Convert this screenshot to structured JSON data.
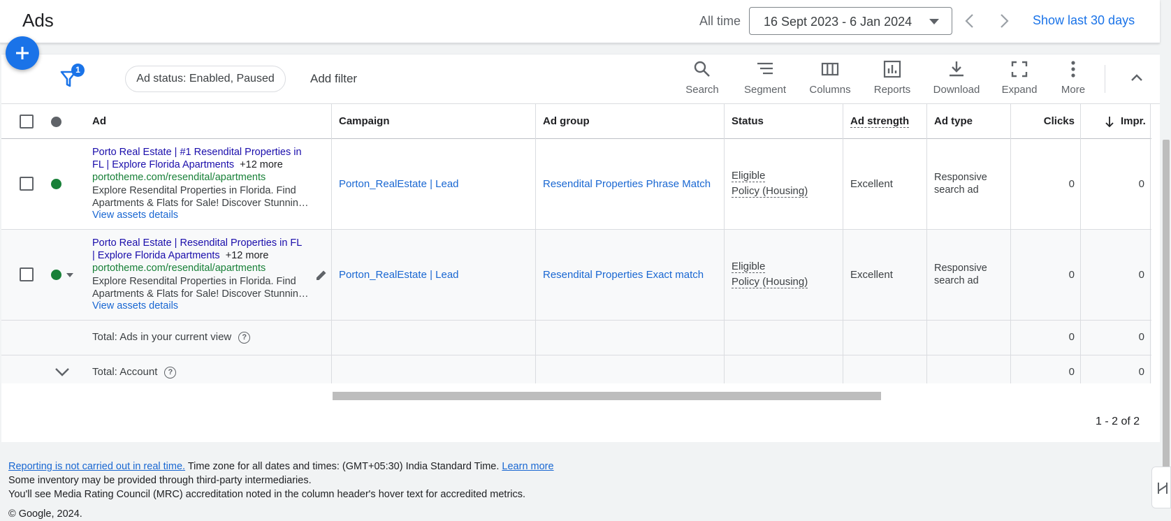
{
  "header": {
    "title": "Ads",
    "date_label": "All time",
    "date_range": "16 Sept 2023 - 6 Jan 2024",
    "show_last": "Show last 30 days"
  },
  "toolbar": {
    "filter_count": "1",
    "status_chip": "Ad status: Enabled, Paused",
    "add_filter": "Add filter",
    "tools": [
      {
        "label": "Search",
        "icon": "search-icon"
      },
      {
        "label": "Segment",
        "icon": "segment-icon"
      },
      {
        "label": "Columns",
        "icon": "columns-icon"
      },
      {
        "label": "Reports",
        "icon": "reports-icon"
      },
      {
        "label": "Download",
        "icon": "download-icon"
      },
      {
        "label": "Expand",
        "icon": "expand-icon"
      },
      {
        "label": "More",
        "icon": "more-vert-icon"
      }
    ]
  },
  "table": {
    "columns": {
      "ad": "Ad",
      "campaign": "Campaign",
      "ad_group": "Ad group",
      "status": "Status",
      "ad_strength": "Ad strength",
      "ad_type": "Ad type",
      "clicks": "Clicks",
      "impr": "Impr."
    },
    "rows": [
      {
        "headline_1": "Porto Real Estate | #1 Resendital Properties in",
        "headline_2": "FL | Explore Florida Apartments",
        "more": "+12 more",
        "url": "portotheme.com/resendital/apartments",
        "desc_1": "Explore Resendital Properties in Florida. Find",
        "desc_2": "Apartments & Flats for Sale! Discover Stunning Homes",
        "assets_link": "View assets details",
        "campaign": "Porton_RealEstate | Lead",
        "ad_group": "Resendital Properties Phrase Match",
        "status_1": "Eligible",
        "status_2": "Policy (Housing)",
        "ad_strength": "Excellent",
        "ad_type_1": "Responsive",
        "ad_type_2": "search ad",
        "clicks": "0",
        "impr": "0"
      },
      {
        "headline_1": "Porto Real Estate | Resendital Properties in FL",
        "headline_2": "| Explore Florida Apartments",
        "more": "+12 more",
        "url": "portotheme.com/resendital/apartments",
        "desc_1": "Explore Resendital Properties in Florida. Find",
        "desc_2": "Apartments & Flats for Sale! Discover Stunning Homes",
        "assets_link": "View assets details",
        "campaign": "Porton_RealEstate | Lead",
        "ad_group": "Resendital Properties Exact match",
        "status_1": "Eligible",
        "status_2": "Policy (Housing)",
        "ad_strength": "Excellent",
        "ad_type_1": "Responsive",
        "ad_type_2": "search ad",
        "clicks": "0",
        "impr": "0"
      }
    ],
    "totals": [
      {
        "label": "Total: Ads in your current view",
        "clicks": "0",
        "impr": "0"
      },
      {
        "label": "Total: Account",
        "clicks": "0",
        "impr": "0"
      }
    ]
  },
  "pagination": "1 - 2 of 2",
  "footer": {
    "link_1": "Reporting is not carried out in real time.",
    "text_1": " Time zone for all dates and times: (GMT+05:30) India Standard Time. ",
    "link_2": "Learn more",
    "line_2": "Some inventory may be provided through third-party intermediaries.",
    "line_3": "You'll see Media Rating Council (MRC) accreditation noted in the column header's hover text for accredited metrics.",
    "copyright": "© Google, 2024."
  },
  "colors": {
    "accent": "#1a73e8",
    "enabled_dot": "#188038",
    "headline": "#1a0dab",
    "url": "#188038"
  }
}
